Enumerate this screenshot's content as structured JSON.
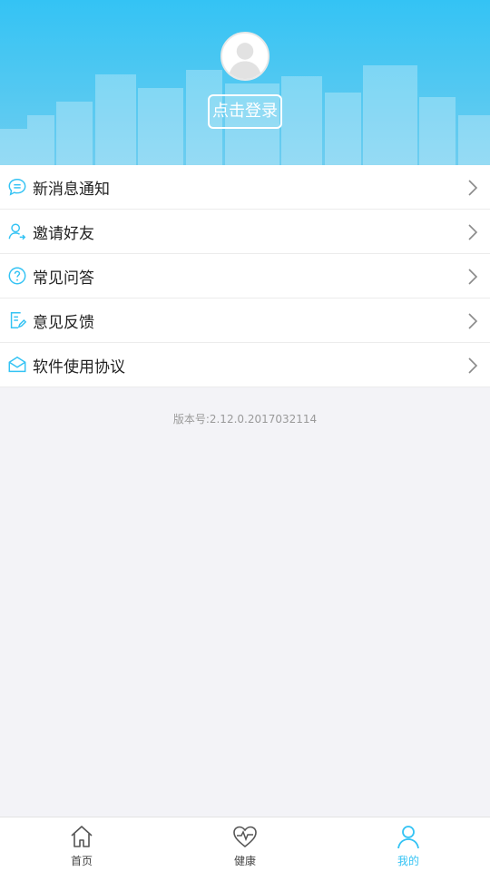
{
  "header": {
    "login_label": "点击登录"
  },
  "menu": [
    {
      "label": "新消息通知",
      "icon": "message-bubble-icon"
    },
    {
      "label": "邀请好友",
      "icon": "invite-user-icon"
    },
    {
      "label": "常见问答",
      "icon": "question-circle-icon"
    },
    {
      "label": "意见反馈",
      "icon": "feedback-document-icon"
    },
    {
      "label": "软件使用协议",
      "icon": "envelope-icon"
    }
  ],
  "version": "版本号:2.12.0.2017032114",
  "tabs": [
    {
      "label": "首页",
      "icon": "home-icon",
      "active": false
    },
    {
      "label": "健康",
      "icon": "heart-pulse-icon",
      "active": false
    },
    {
      "label": "我的",
      "icon": "user-icon",
      "active": true
    }
  ],
  "colors": {
    "accent": "#34c3f4",
    "background": "#f3f3f7"
  }
}
